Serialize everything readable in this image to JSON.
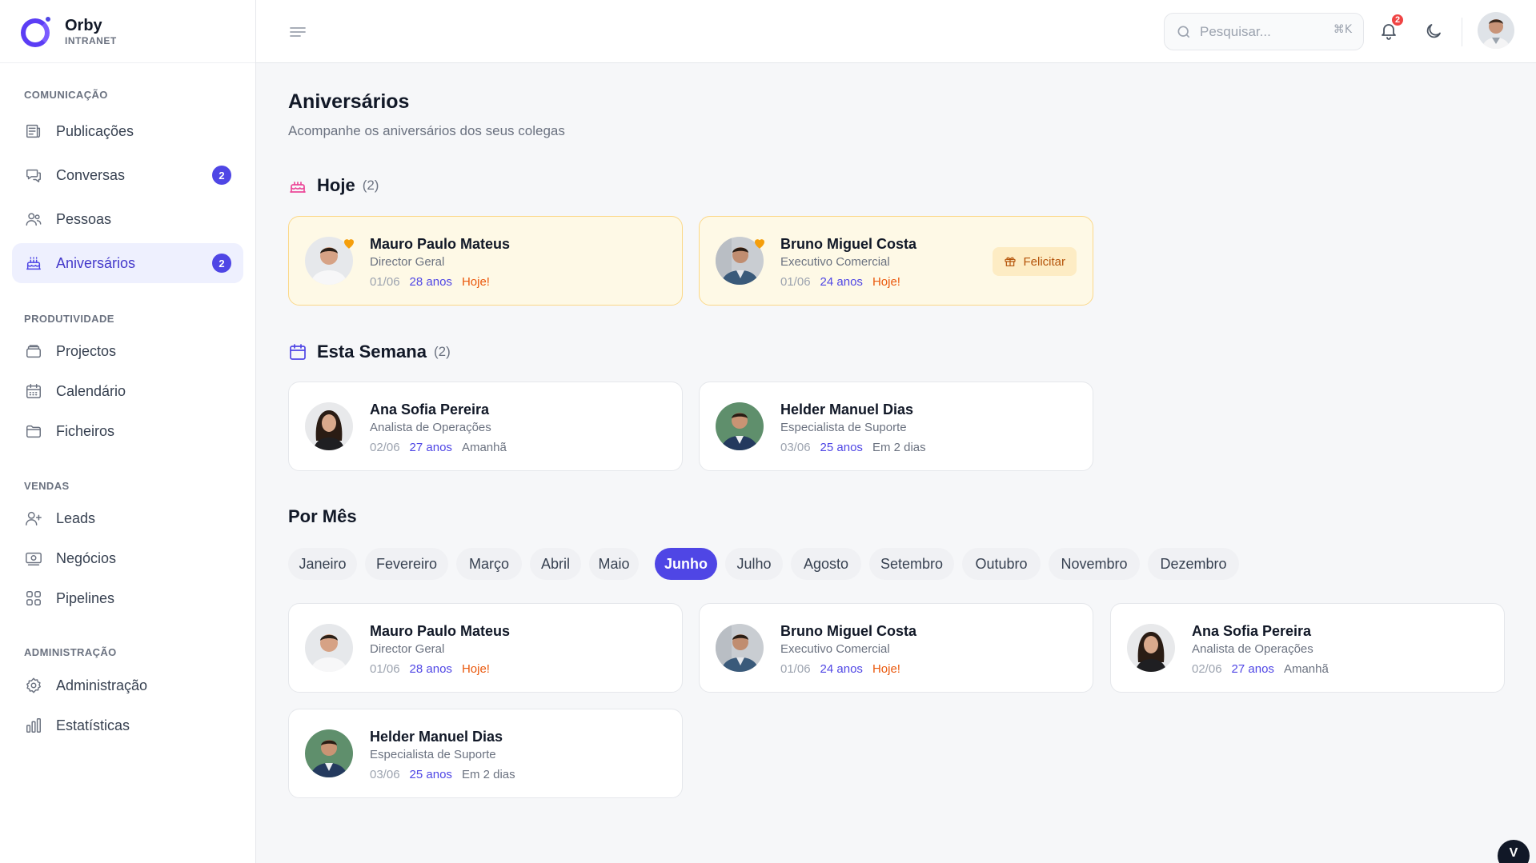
{
  "brand": {
    "name": "Orby",
    "subtitle": "INTRANET"
  },
  "sidebar": {
    "sections": [
      {
        "title": "COMUNICAÇÃO"
      },
      {
        "title": "PRODUTIVIDADE"
      },
      {
        "title": "VENDAS"
      },
      {
        "title": "ADMINISTRAÇÃO"
      }
    ],
    "items": [
      {
        "label": "Publicações",
        "icon": "newspaper-icon"
      },
      {
        "label": "Conversas",
        "icon": "chat-icon",
        "badge": "2"
      },
      {
        "label": "Pessoas",
        "icon": "people-icon"
      },
      {
        "label": "Aniversários",
        "icon": "cake-icon",
        "badge": "2",
        "active": true
      },
      {
        "label": "Projectos",
        "icon": "layers-icon"
      },
      {
        "label": "Calendário",
        "icon": "calendar-icon"
      },
      {
        "label": "Ficheiros",
        "icon": "folder-icon"
      },
      {
        "label": "Leads",
        "icon": "user-plus-icon"
      },
      {
        "label": "Negócios",
        "icon": "money-icon"
      },
      {
        "label": "Pipelines",
        "icon": "grid-icon"
      },
      {
        "label": "Administração",
        "icon": "gear-icon"
      },
      {
        "label": "Estatísticas",
        "icon": "bar-chart-icon"
      }
    ]
  },
  "topbar": {
    "search_placeholder": "Pesquisar...",
    "search_shortcut": "⌘K",
    "notifications_count": "2"
  },
  "page": {
    "title": "Aniversários",
    "subtitle": "Acompanhe os aniversários dos seus colegas"
  },
  "today": {
    "title": "Hoje",
    "count": "(2)",
    "cards": [
      {
        "name": "Mauro Paulo Mateus",
        "role": "Director Geral",
        "date": "01/06",
        "age": "28 anos",
        "when": "Hoje!"
      },
      {
        "name": "Bruno Miguel Costa",
        "role": "Executivo Comercial",
        "date": "01/06",
        "age": "24 anos",
        "when": "Hoje!",
        "action": "Felicitar"
      }
    ]
  },
  "week": {
    "title": "Esta Semana",
    "count": "(2)",
    "cards": [
      {
        "name": "Ana Sofia Pereira",
        "role": "Analista de Operações",
        "date": "02/06",
        "age": "27 anos",
        "when": "Amanhã"
      },
      {
        "name": "Helder Manuel Dias",
        "role": "Especialista de Suporte",
        "date": "03/06",
        "age": "25 anos",
        "when": "Em 2 dias"
      }
    ]
  },
  "by_month": {
    "title": "Por Mês",
    "months": [
      "Janeiro",
      "Fevereiro",
      "Março",
      "Abril",
      "Maio",
      "Junho",
      "Julho",
      "Agosto",
      "Setembro",
      "Outubro",
      "Novembro",
      "Dezembro"
    ],
    "selected": "Junho",
    "cards": [
      {
        "name": "Mauro Paulo Mateus",
        "role": "Director Geral",
        "date": "01/06",
        "age": "28 anos",
        "when": "Hoje!"
      },
      {
        "name": "Bruno Miguel Costa",
        "role": "Executivo Comercial",
        "date": "01/06",
        "age": "24 anos",
        "when": "Hoje!"
      },
      {
        "name": "Ana Sofia Pereira",
        "role": "Analista de Operações",
        "date": "02/06",
        "age": "27 anos",
        "when": "Amanhã"
      },
      {
        "name": "Helder Manuel Dias",
        "role": "Especialista de Suporte",
        "date": "03/06",
        "age": "25 anos",
        "when": "Em 2 dias"
      }
    ]
  },
  "corner_button": "V",
  "colors": {
    "accent": "#4f46e5",
    "today_bg": "#fef9e6",
    "today_border": "#fbd889",
    "hoje": "#ea580c"
  }
}
